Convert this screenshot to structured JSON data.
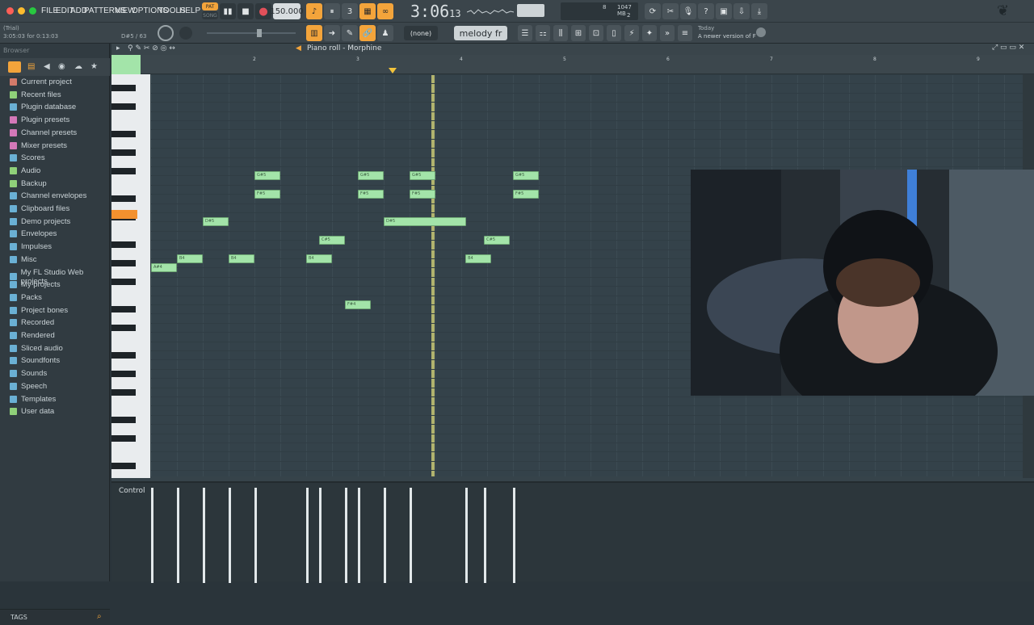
{
  "menu": [
    "FILE",
    "EDIT",
    "ADD",
    "PATTERNS",
    "VIEW",
    "OPTIONS",
    "TOOLS",
    "HELP"
  ],
  "transport": {
    "pat_label": "PAT",
    "song_label": "SONG",
    "tempo": "150.000",
    "time": "3:06",
    "time_small": "13",
    "cpu": "1047 MB",
    "poly": "8",
    "voices": "2"
  },
  "hint": {
    "trial": "(Trial)",
    "position": "3:05:03 for 0:13:03",
    "note": "D#5 / 63"
  },
  "toolbar": {
    "snap": "(none)",
    "pattern": "melody fr"
  },
  "news": {
    "date": "Today",
    "text": "A newer version of FL Studio i..."
  },
  "browser": {
    "title": "Browser",
    "tags": "TAGS",
    "items": [
      {
        "label": "Current project",
        "color": "#d47b6a"
      },
      {
        "label": "Recent files",
        "color": "#8fd079"
      },
      {
        "label": "Plugin database",
        "color": "#6ab0d4"
      },
      {
        "label": "Plugin presets",
        "color": "#d478b8"
      },
      {
        "label": "Channel presets",
        "color": "#d478b8"
      },
      {
        "label": "Mixer presets",
        "color": "#d478b8"
      },
      {
        "label": "Scores",
        "color": "#6ab0d4"
      },
      {
        "label": "Audio",
        "color": "#8fd079"
      },
      {
        "label": "Backup",
        "color": "#8fd079"
      },
      {
        "label": "Channel envelopes",
        "color": "#6ab0d4"
      },
      {
        "label": "Clipboard files",
        "color": "#6ab0d4"
      },
      {
        "label": "Demo projects",
        "color": "#6ab0d4"
      },
      {
        "label": "Envelopes",
        "color": "#6ab0d4"
      },
      {
        "label": "Impulses",
        "color": "#6ab0d4"
      },
      {
        "label": "Misc",
        "color": "#6ab0d4"
      },
      {
        "label": "My FL Studio Web projects",
        "color": "#6ab0d4"
      },
      {
        "label": "My projects",
        "color": "#6ab0d4"
      },
      {
        "label": "Packs",
        "color": "#6ab0d4"
      },
      {
        "label": "Project bones",
        "color": "#6ab0d4"
      },
      {
        "label": "Recorded",
        "color": "#6ab0d4"
      },
      {
        "label": "Rendered",
        "color": "#6ab0d4"
      },
      {
        "label": "Sliced audio",
        "color": "#6ab0d4"
      },
      {
        "label": "Soundfonts",
        "color": "#6ab0d4"
      },
      {
        "label": "Sounds",
        "color": "#6ab0d4"
      },
      {
        "label": "Speech",
        "color": "#6ab0d4"
      },
      {
        "label": "Templates",
        "color": "#6ab0d4"
      },
      {
        "label": "User data",
        "color": "#8fd079"
      }
    ]
  },
  "pianoroll": {
    "title": "Piano roll - Morphine",
    "control": "Control",
    "bars": [
      "2",
      "3",
      "4",
      "5",
      "6",
      "7",
      "8",
      "9"
    ],
    "notes": [
      {
        "label": "A#4",
        "bar": 1.0,
        "len": 0.25,
        "row": 10
      },
      {
        "label": "B4",
        "bar": 1.25,
        "len": 0.25,
        "row": 9
      },
      {
        "label": "D#5",
        "bar": 1.5,
        "len": 0.25,
        "row": 5
      },
      {
        "label": "B4",
        "bar": 1.75,
        "len": 0.25,
        "row": 9
      },
      {
        "label": "G#5",
        "bar": 2.0,
        "len": 0.25,
        "row": 0
      },
      {
        "label": "F#5",
        "bar": 2.0,
        "len": 0.25,
        "row": 2
      },
      {
        "label": "B4",
        "bar": 2.5,
        "len": 0.25,
        "row": 9
      },
      {
        "label": "C#5",
        "bar": 2.625,
        "len": 0.25,
        "row": 7
      },
      {
        "label": "F#4",
        "bar": 2.875,
        "len": 0.25,
        "row": 14
      },
      {
        "label": "G#5",
        "bar": 3.0,
        "len": 0.25,
        "row": 0
      },
      {
        "label": "F#5",
        "bar": 3.0,
        "len": 0.25,
        "row": 2
      },
      {
        "label": "D#5",
        "bar": 3.25,
        "len": 0.8,
        "row": 5
      },
      {
        "label": "G#5",
        "bar": 3.5,
        "len": 0.25,
        "row": 0
      },
      {
        "label": "F#5",
        "bar": 3.5,
        "len": 0.25,
        "row": 2
      },
      {
        "label": "B4",
        "bar": 4.04,
        "len": 0.25,
        "row": 9
      },
      {
        "label": "C#5",
        "bar": 4.22,
        "len": 0.25,
        "row": 7
      },
      {
        "label": "G#5",
        "bar": 4.5,
        "len": 0.25,
        "row": 0
      },
      {
        "label": "F#5",
        "bar": 4.5,
        "len": 0.25,
        "row": 2
      }
    ]
  }
}
